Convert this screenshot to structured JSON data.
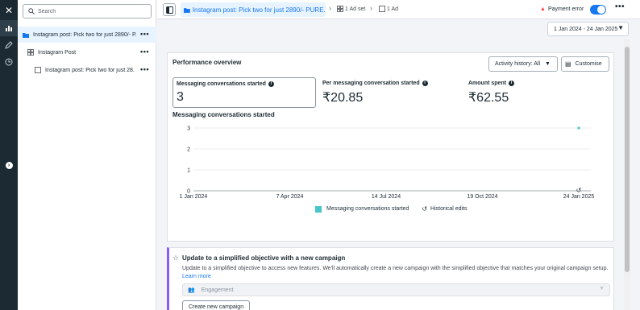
{
  "search": {
    "placeholder": "Search"
  },
  "tree": {
    "campaign": {
      "label": "Instagram post: Pick two for just 2890/- P...",
      "more": "•••"
    },
    "adset": {
      "label": "Instagram Post",
      "more": "•••"
    },
    "ad": {
      "label": "Instagram post: Pick two for just 28...",
      "more": "•••"
    }
  },
  "topbar": {
    "campaign_crumb": "Instagram post: Pick two for just 2890/- PURE...",
    "adset_crumb": "1 Ad set",
    "ad_crumb": "1 Ad",
    "payment_error": "Payment error",
    "more": "•••"
  },
  "date_range": "1 Jan 2024 - 24 Jan 2025",
  "performance": {
    "title": "Performance overview",
    "activity_button": "Activity history: All",
    "customise_button": "Customise",
    "metrics": [
      {
        "label": "Messaging conversations started",
        "value": "3"
      },
      {
        "label": "Per messaging conversation started",
        "value": "₹20.85"
      },
      {
        "label": "Amount spent",
        "value": "₹62.55"
      }
    ],
    "chart_title": "Messaging conversations started",
    "legend_series": "Messaging conversations started",
    "legend_historical": "Historical edits"
  },
  "chart_data": {
    "type": "line",
    "title": "Messaging conversations started",
    "xlabel": "",
    "ylabel": "",
    "x_ticks": [
      "1 Jan 2024",
      "7 Apr 2024",
      "14 Jul 2024",
      "19 Oct 2024",
      "24 Jan 2025"
    ],
    "y_ticks": [
      "0",
      "1",
      "2",
      "3"
    ],
    "ylim": [
      0,
      3
    ],
    "xlim": [
      "2024-01-01",
      "2025-01-24"
    ],
    "grid": true,
    "legend": "bottom",
    "series": [
      {
        "name": "Messaging conversations started",
        "color": "#47c5cb",
        "points": [
          {
            "x": "2025-01-24",
            "y": 3
          }
        ]
      }
    ],
    "annotations": [
      {
        "x": "2025-01-24",
        "type": "historical-edit"
      }
    ]
  },
  "upsell": {
    "title": "Update to a simplified objective with a new campaign",
    "description": "Update to a simplified objective to access new features. We'll automatically create a new campaign with the simplified objective that matches your original campaign setup.",
    "learn_more": "Learn more",
    "objective_value": "Engagement",
    "create_button": "Create new campaign"
  },
  "colors": {
    "accent": "#1877f2",
    "series": "#47c5cb",
    "rail": "#1c2b33",
    "error": "#fa383e",
    "upsell_border": "#8a5cf6"
  }
}
